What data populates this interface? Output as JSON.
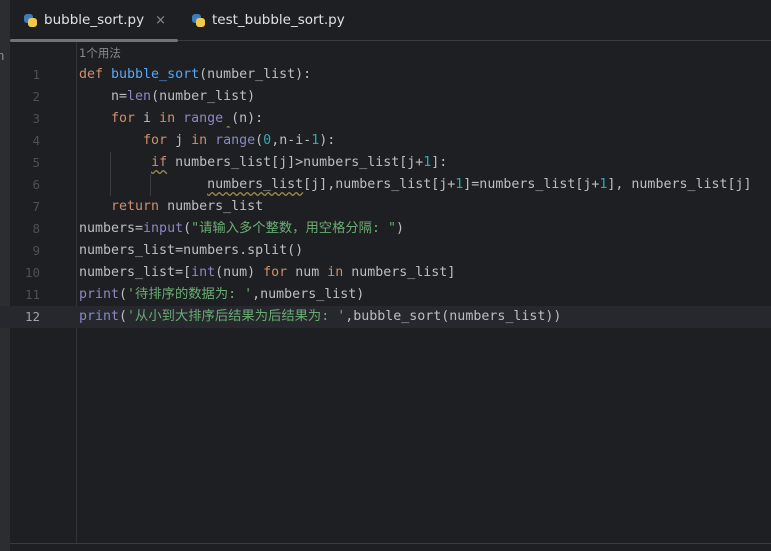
{
  "tabs": [
    {
      "label": "bubble_sort.py",
      "active": true,
      "icon": "python-icon",
      "close": "×"
    },
    {
      "label": "test_bubble_sort.py",
      "active": false,
      "icon": "python-icon"
    }
  ],
  "left_panel_text": "h",
  "usage_hint": "1个用法",
  "current_line": 12,
  "colors": {
    "keyword": "#cf8e6d",
    "function": "#56a8f5",
    "builtin": "#8888c6",
    "number": "#2aacb8",
    "string": "#6aab73",
    "text": "#bcbec4",
    "background": "#1e1f22"
  },
  "lines": [
    {
      "n": "1",
      "tokens": [
        [
          "def ",
          "k"
        ],
        [
          "bubble_sort",
          "f"
        ],
        [
          "(number_list):",
          "p"
        ]
      ]
    },
    {
      "n": "2",
      "tokens": [
        [
          "    n=",
          "p"
        ],
        [
          "len",
          "b"
        ],
        [
          "(number_list)",
          "p"
        ]
      ]
    },
    {
      "n": "3",
      "tokens": [
        [
          "    for ",
          "k"
        ],
        [
          "i ",
          "p"
        ],
        [
          "in ",
          "k"
        ],
        [
          "range",
          "b"
        ],
        [
          " ",
          "w"
        ],
        [
          "(n):",
          "p"
        ]
      ]
    },
    {
      "n": "4",
      "tokens": [
        [
          "        for ",
          "k"
        ],
        [
          "j ",
          "p"
        ],
        [
          "in ",
          "k"
        ],
        [
          "range",
          "b"
        ],
        [
          "(",
          "p"
        ],
        [
          "0",
          "n"
        ],
        [
          ",n-i-",
          "p"
        ],
        [
          "1",
          "n"
        ],
        [
          "):",
          "p"
        ]
      ]
    },
    {
      "n": "5",
      "tokens": [
        [
          "         ",
          "p"
        ],
        [
          "if",
          "kw"
        ],
        [
          " numbers_list[j]>numbers_list[j+",
          "p"
        ],
        [
          "1",
          "n"
        ],
        [
          "]:",
          "p"
        ]
      ]
    },
    {
      "n": "6",
      "tokens": [
        [
          "                ",
          "p"
        ],
        [
          "numbers_list",
          "pw"
        ],
        [
          "[j],numbers_list[j+",
          "p"
        ],
        [
          "1",
          "n"
        ],
        [
          "]=numbers_list[j+",
          "p"
        ],
        [
          "1",
          "n"
        ],
        [
          "], numbers_list[j]",
          "p"
        ]
      ]
    },
    {
      "n": "7",
      "tokens": [
        [
          "    return ",
          "k"
        ],
        [
          "numbers_list",
          "p"
        ]
      ]
    },
    {
      "n": "8",
      "tokens": [
        [
          "numbers=",
          "p"
        ],
        [
          "input",
          "b"
        ],
        [
          "(",
          "p"
        ],
        [
          "\"请输入多个整数，用空格分隔: \"",
          "s"
        ],
        [
          ")",
          "p"
        ]
      ]
    },
    {
      "n": "9",
      "tokens": [
        [
          "numbers_list=numbers.split()",
          "p"
        ]
      ]
    },
    {
      "n": "10",
      "tokens": [
        [
          "numbers_list=[",
          "p"
        ],
        [
          "int",
          "b"
        ],
        [
          "(num) ",
          "p"
        ],
        [
          "for ",
          "k"
        ],
        [
          "num ",
          "p"
        ],
        [
          "in ",
          "k"
        ],
        [
          "numbers_list]",
          "p"
        ]
      ]
    },
    {
      "n": "11",
      "tokens": [
        [
          "print",
          "b"
        ],
        [
          "(",
          "p"
        ],
        [
          "'待排序的数据为: '",
          "s"
        ],
        [
          ",numbers_list)",
          "p"
        ]
      ]
    },
    {
      "n": "12",
      "tokens": [
        [
          "print",
          "b"
        ],
        [
          "(",
          "p"
        ],
        [
          "'从小到大排序后结果为后结果为: '",
          "s"
        ],
        [
          ",bubble_sort(numbers_list))",
          "p"
        ]
      ]
    }
  ]
}
